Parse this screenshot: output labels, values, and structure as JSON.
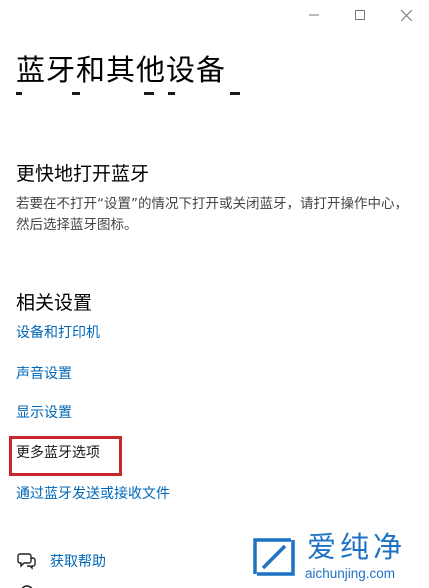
{
  "window": {
    "minimize_icon": "minimize-icon",
    "maximize_icon": "maximize-icon",
    "close_icon": "close-icon"
  },
  "page": {
    "title": "蓝牙和其他设备"
  },
  "quick_section": {
    "heading": "更快地打开蓝牙",
    "description": "若要在不打开“设置”的情况下打开或关闭蓝牙，请打开操作中心，然后选择蓝牙图标。"
  },
  "related_section": {
    "heading": "相关设置",
    "links": [
      "设备和打印机",
      "声音设置",
      "显示设置",
      "更多蓝牙选项",
      "通过蓝牙发送或接收文件"
    ]
  },
  "help": {
    "get_help": "获取帮助",
    "get_help_icon": "help-chat-icon"
  },
  "watermark": {
    "title": "爱纯净",
    "url": "aichunjing.com"
  },
  "colors": {
    "link": "#0067b8",
    "highlight": "#c9262a",
    "watermark": "#1e72c6"
  }
}
